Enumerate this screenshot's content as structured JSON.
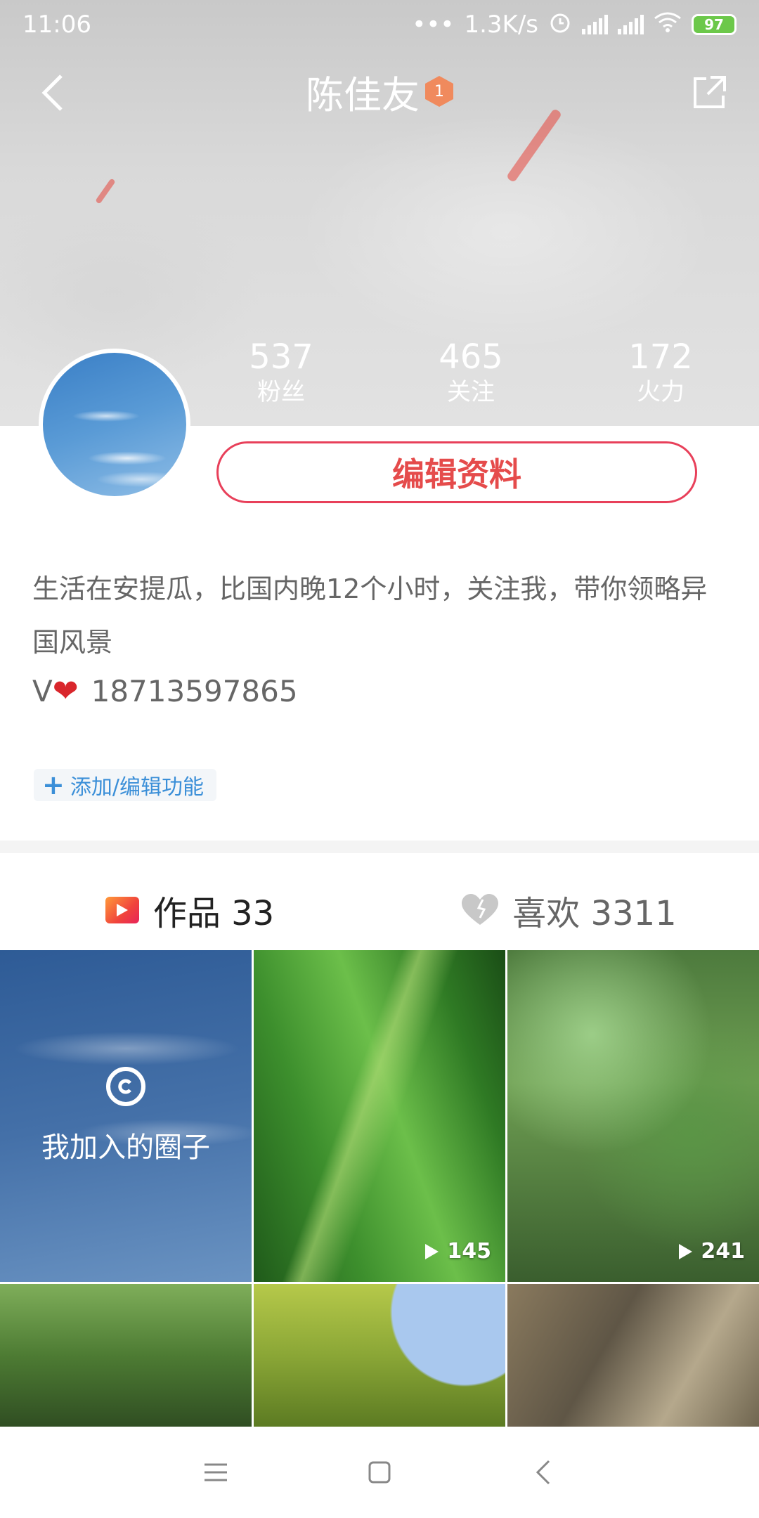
{
  "status_bar": {
    "time": "11:06",
    "speed": "1.3K/s",
    "battery": "97"
  },
  "header": {
    "title": "陈佳友",
    "level": "1"
  },
  "stats": [
    {
      "value": "537",
      "label": "粉丝"
    },
    {
      "value": "465",
      "label": "关注"
    },
    {
      "value": "172",
      "label": "火力"
    }
  ],
  "edit_profile_label": "编辑资料",
  "bio": {
    "text": "生活在安提瓜，比国内晚12个小时，关注我，带你领略异国风景",
    "contact_prefix": "V",
    "phone": "18713597865"
  },
  "add_function_label": "添加/编辑功能",
  "tabs": {
    "works_label": "作品 33",
    "likes_label": "喜欢 3311"
  },
  "grid": {
    "circle_label": "我加入的圈子",
    "play_counts": [
      "145",
      "241"
    ]
  },
  "colors": {
    "accent": "#e54b4b",
    "link": "#3b8fd8"
  }
}
